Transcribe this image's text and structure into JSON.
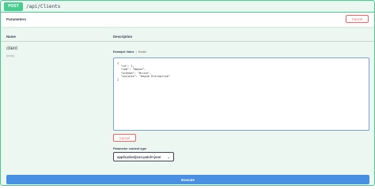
{
  "operation": {
    "method": "POST",
    "path": "/api/Clients"
  },
  "parameters_section": {
    "title": "Parameters",
    "cancel_label": "Cancel"
  },
  "table_headers": {
    "name": "Name",
    "description": "Description"
  },
  "parameter": {
    "name": "client",
    "location": "(body)"
  },
  "example_tabs": {
    "example_value": "Example Value",
    "separator": "|",
    "model": "Model"
  },
  "body_editor": {
    "value": "{\n  \"id\": 1,\n  \"nom\": \"Wayne\",\n  \"prenom\": \"Bruce\",\n  \"societe\": \"Wayne Entreprise\"\n}"
  },
  "body_cancel_label": "Cancel",
  "content_type": {
    "label": "Parameter content type",
    "selected": "application/json-patch+json"
  },
  "execute_label": "Execute",
  "colors": {
    "post_green": "#49cc90",
    "cancel_red": "#ff6060",
    "execute_blue": "#4990e2",
    "background": "#edf7f1"
  }
}
